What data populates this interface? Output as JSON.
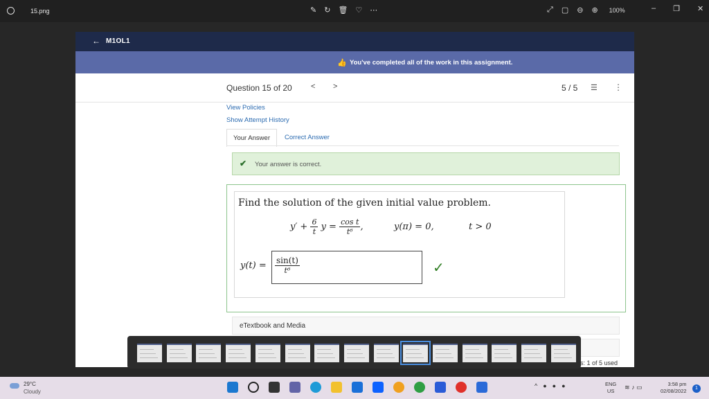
{
  "viewer": {
    "filename": "15.png",
    "zoom": "100%"
  },
  "course": {
    "back_icon": "arrow-left-icon",
    "name": "M1OL1"
  },
  "banner": {
    "icon": "thumbs-up-icon",
    "message": "You've completed all of the work in this assignment."
  },
  "question_nav": {
    "title": "Question 15 of 20",
    "prev": "<",
    "next": ">",
    "score": "5 / 5"
  },
  "links": {
    "view_policies": "View Policies",
    "attempt_history": "Show Attempt History"
  },
  "tabs": [
    {
      "label": "Your Answer",
      "active": true
    },
    {
      "label": "Correct Answer",
      "active": false
    }
  ],
  "feedback": {
    "message": "Your answer is correct."
  },
  "problem": {
    "prompt": "Find the solution of the given initial value problem.",
    "coef_num": "6",
    "coef_den": "t",
    "rhs_num": "cos t",
    "rhs_den": "t⁶",
    "initial_condition": "y(π) = 0,",
    "domain": "t > 0",
    "answer_label": "y(t) =",
    "answer_num": "sin(t)",
    "answer_den": "t⁶"
  },
  "resources": {
    "ebook": "eTextbook and Media"
  },
  "attempts": "s: 1 of 5 used",
  "taskbar": {
    "temperature": "29°C",
    "condition": "Cloudy",
    "lang_top": "ENG",
    "lang_bottom": "US",
    "time": "3:58 pm",
    "date": "02/08/2022",
    "notifications": "1"
  },
  "colors": {
    "course_bar": "#1e2a4a",
    "banner": "#5a6aa8",
    "success_bg": "#e0f1da",
    "link": "#2a6ab0"
  }
}
